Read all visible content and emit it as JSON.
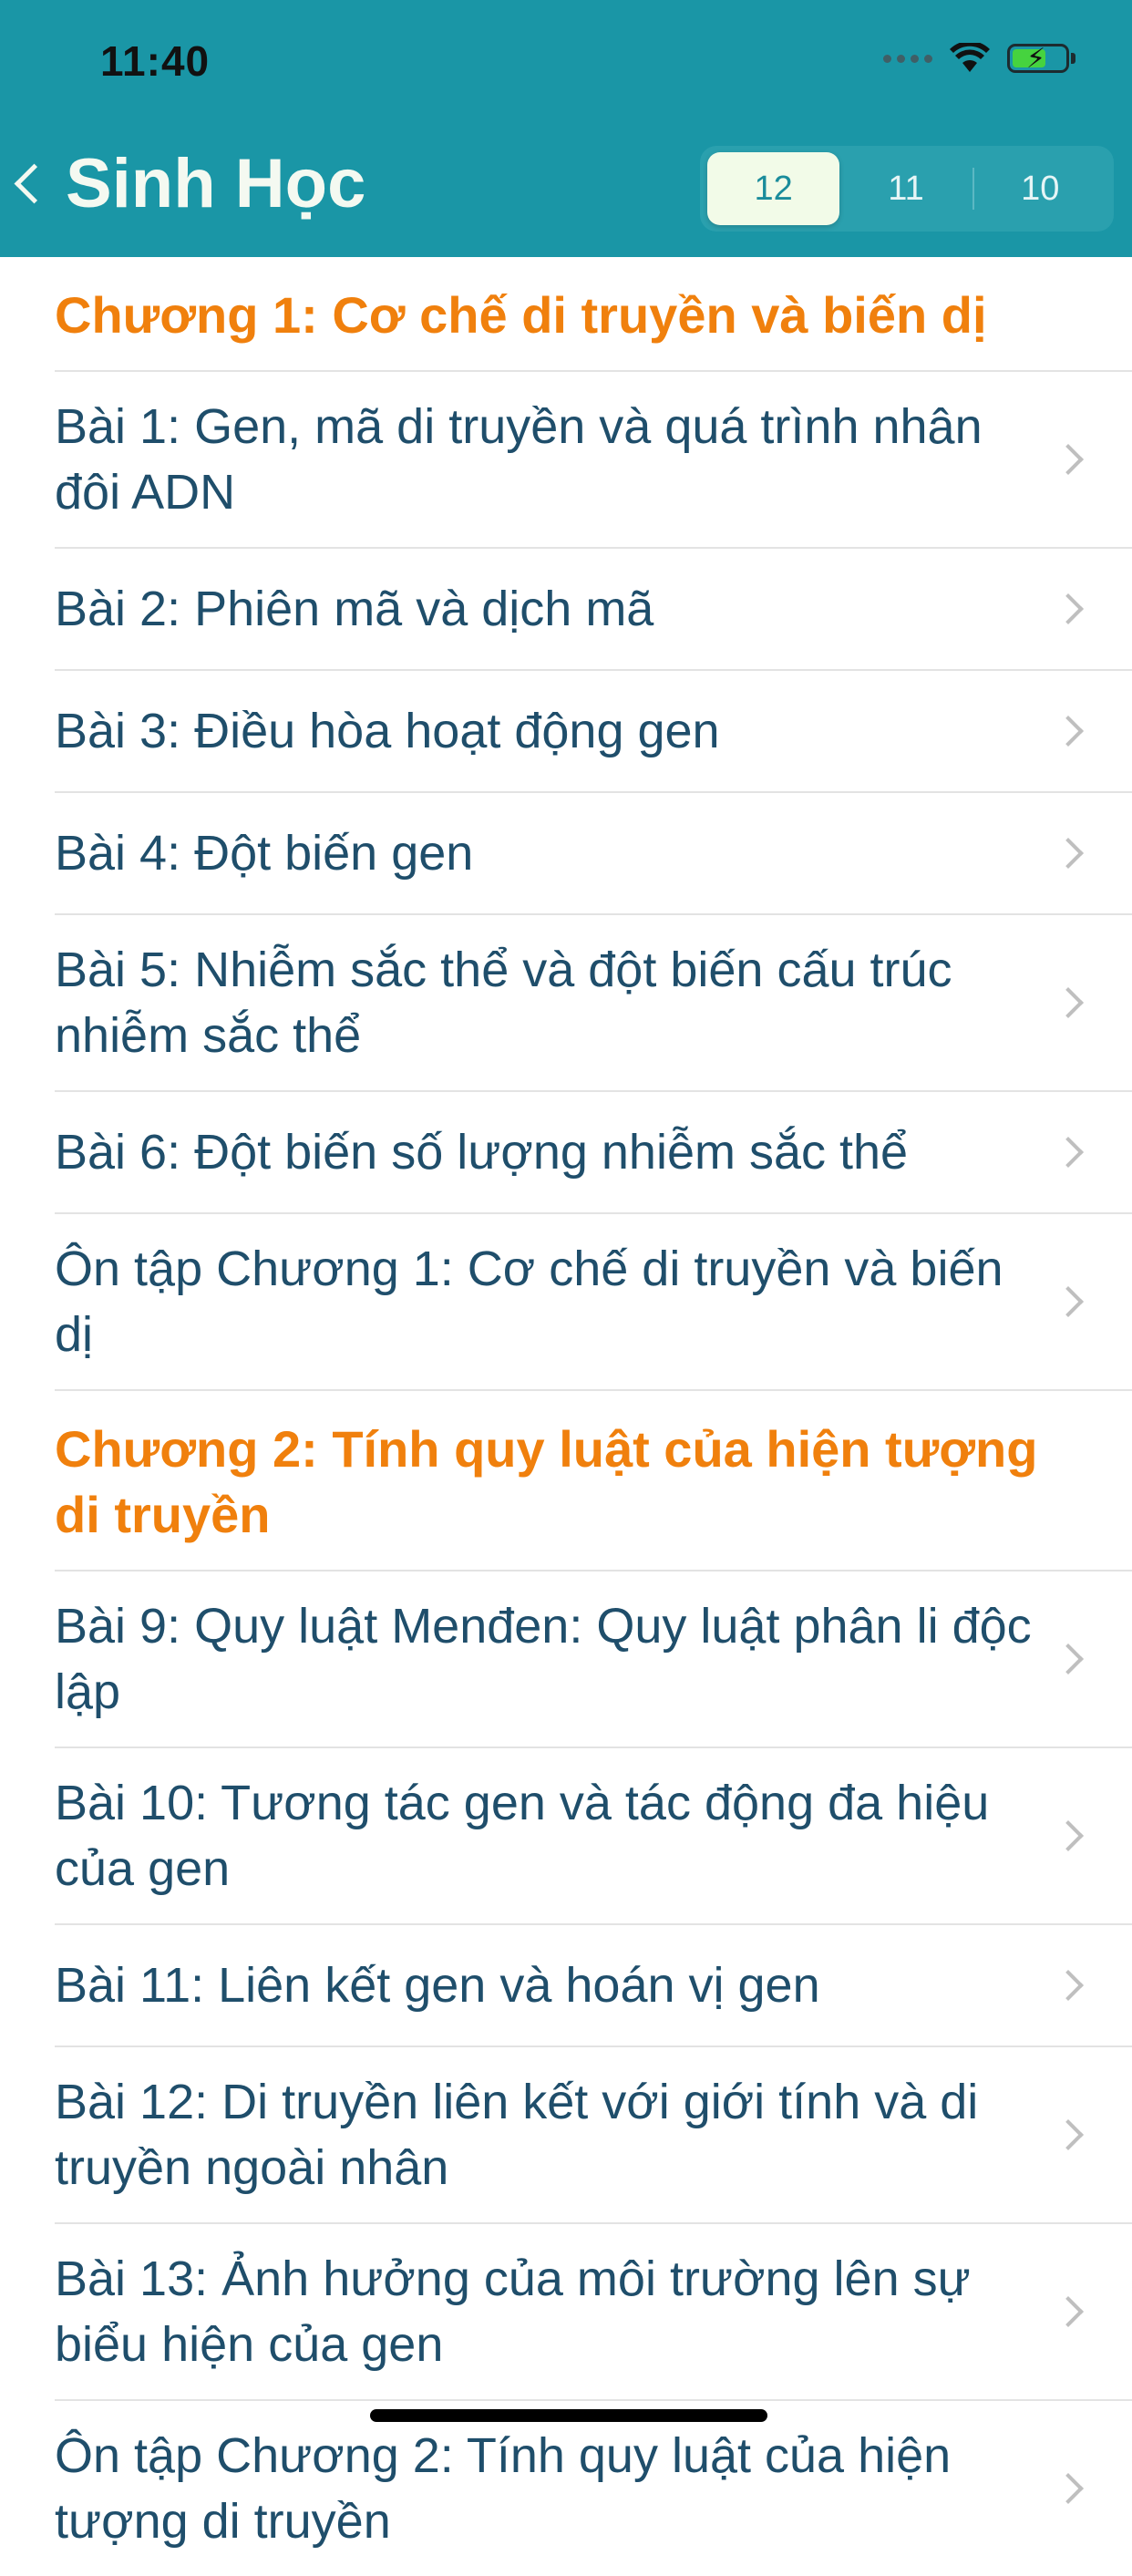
{
  "status": {
    "time": "11:40"
  },
  "nav": {
    "title": "Sinh Học",
    "grades": [
      "12",
      "11",
      "10"
    ],
    "selected_grade": "12"
  },
  "chapters": [
    {
      "title": "Chương 1: Cơ chế di truyền và biến dị",
      "lessons": [
        "Bài 1: Gen, mã di truyền và quá trình nhân đôi ADN",
        "Bài 2: Phiên mã và dịch mã",
        "Bài 3: Điều hòa hoạt động gen",
        "Bài 4: Đột biến gen",
        "Bài 5: Nhiễm sắc thể và đột biến cấu trúc nhiễm sắc thể",
        "Bài 6: Đột biến số lượng nhiễm sắc thể",
        "Ôn tập Chương 1: Cơ chế di truyền và biến dị"
      ]
    },
    {
      "title": "Chương 2: Tính quy luật của hiện tượng di truyền",
      "lessons": [
        "Bài 9: Quy luật Menđen: Quy luật phân li độc lập",
        "Bài 10: Tương tác gen và tác động đa hiệu của gen",
        "Bài 11: Liên kết gen và hoán vị gen",
        "Bài 12: Di truyền liên kết với giới tính và di truyền ngoài nhân",
        "Bài 13: Ảnh hưởng của môi trường lên sự biểu hiện của gen",
        "Ôn tập Chương 2: Tính quy luật của hiện tượng di truyền"
      ]
    }
  ],
  "colors": {
    "header": "#1a96a6",
    "chapter_title": "#f0800d",
    "lesson_text": "#1f4e6b"
  }
}
